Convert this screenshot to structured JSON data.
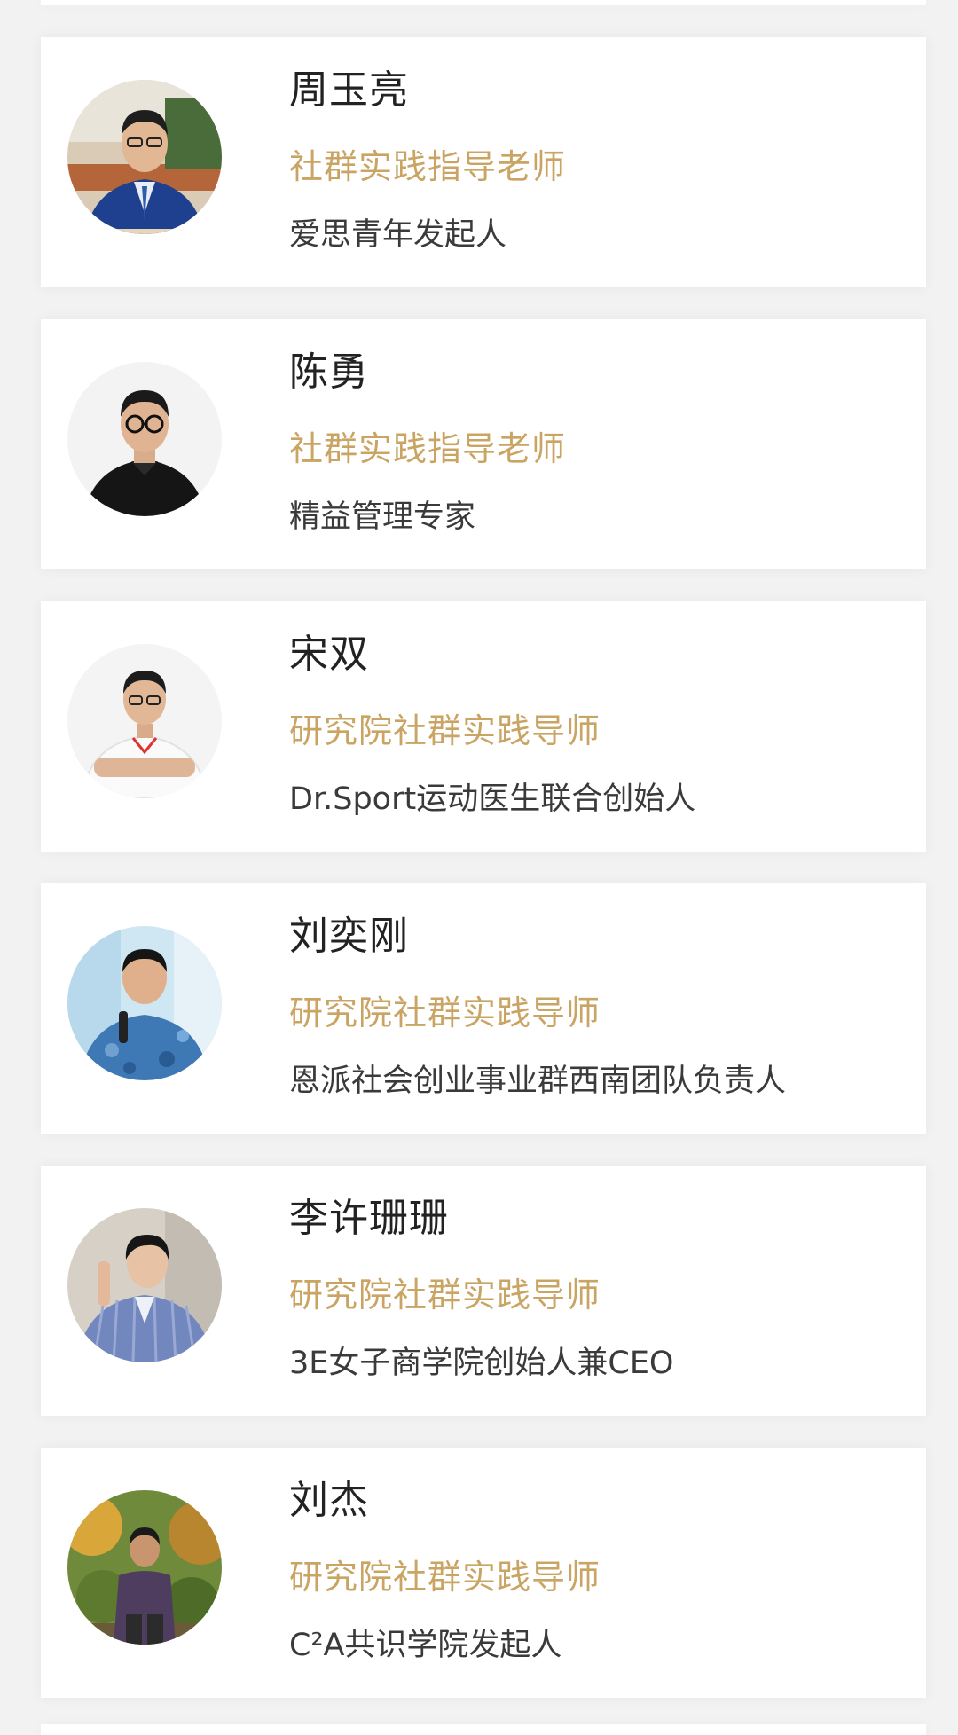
{
  "colors": {
    "background": "#f2f2f2",
    "card": "#ffffff",
    "name": "#222222",
    "role": "#c9a463",
    "description": "#3a3a3a"
  },
  "mentors": [
    {
      "name": "周玉亮",
      "role": "社群实践指导老师",
      "description": "爱思青年发起人",
      "avatar": "portrait-man-suit-office"
    },
    {
      "name": "陈勇",
      "role": "社群实践指导老师",
      "description": "精益管理专家",
      "avatar": "portrait-man-glasses-black-shirt"
    },
    {
      "name": "宋双",
      "role": "研究院社群实践导师",
      "description": "Dr.Sport运动医生联合创始人",
      "avatar": "portrait-man-white-polo-arms-crossed"
    },
    {
      "name": "刘奕刚",
      "role": "研究院社群实践导师",
      "description": "恩派社会创业事业群西南团队负责人",
      "avatar": "portrait-man-patterned-shirt-microphone"
    },
    {
      "name": "李许珊珊",
      "role": "研究院社群实践导师",
      "description": "3E女子商学院创始人兼CEO",
      "avatar": "portrait-woman-striped-blazer"
    },
    {
      "name": "刘杰",
      "role": "研究院社群实践导师",
      "description": "C²A共识学院发起人",
      "avatar": "portrait-man-outdoor-autumn"
    }
  ]
}
